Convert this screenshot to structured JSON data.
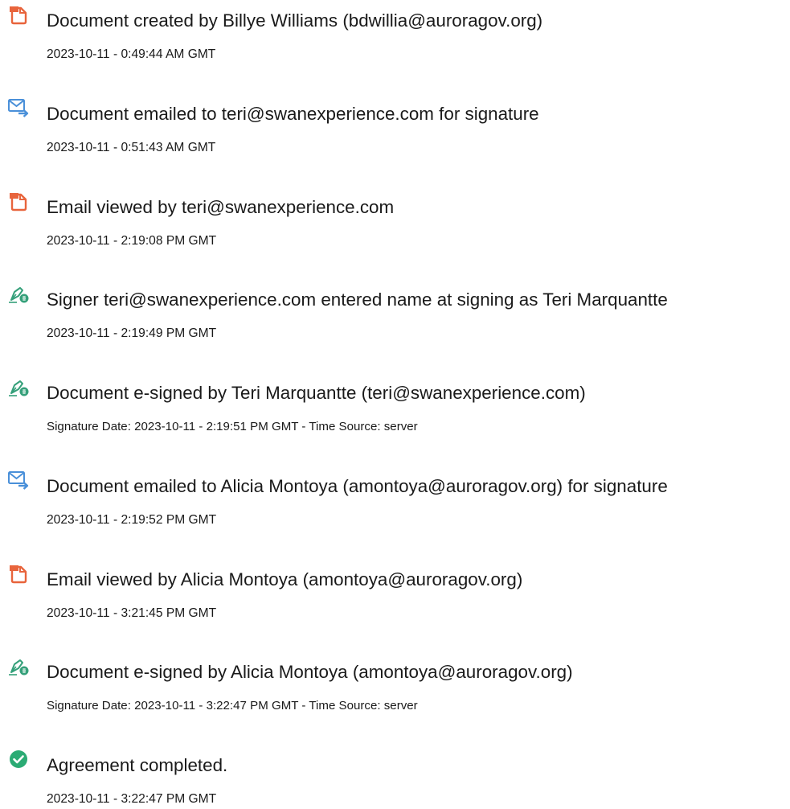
{
  "colors": {
    "doc_icon": "#e8643c",
    "mail_icon": "#4a90d9",
    "sign_icon": "#35a07a",
    "check_icon": "#2bab74",
    "text": "#1a1a1a"
  },
  "events": [
    {
      "icon": "document-icon",
      "title": "Document created by Billye Williams (bdwillia@auroragov.org)",
      "time": "2023-10-11 - 0:49:44 AM GMT"
    },
    {
      "icon": "email-sent-icon",
      "title": "Document emailed to teri@swanexperience.com for signature",
      "time": "2023-10-11 - 0:51:43 AM GMT"
    },
    {
      "icon": "document-icon",
      "title": "Email viewed by teri@swanexperience.com",
      "time": "2023-10-11 - 2:19:08 PM GMT"
    },
    {
      "icon": "signer-pen-icon",
      "title": "Signer teri@swanexperience.com entered name at signing as Teri Marquantte",
      "time": "2023-10-11 - 2:19:49 PM GMT"
    },
    {
      "icon": "signer-pen-icon",
      "title": "Document e-signed by Teri Marquantte (teri@swanexperience.com)",
      "time": "Signature Date: 2023-10-11 - 2:19:51 PM GMT - Time Source: server"
    },
    {
      "icon": "email-sent-icon",
      "title": "Document emailed to Alicia Montoya (amontoya@auroragov.org) for signature",
      "time": "2023-10-11 - 2:19:52 PM GMT"
    },
    {
      "icon": "document-icon",
      "title": "Email viewed by Alicia Montoya (amontoya@auroragov.org)",
      "time": "2023-10-11 - 3:21:45 PM GMT"
    },
    {
      "icon": "signer-pen-icon",
      "title": "Document e-signed by Alicia Montoya (amontoya@auroragov.org)",
      "time": "Signature Date: 2023-10-11 - 3:22:47 PM GMT - Time Source: server"
    },
    {
      "icon": "check-circle-icon",
      "title": "Agreement completed.",
      "time": "2023-10-11 - 3:22:47 PM GMT"
    }
  ]
}
